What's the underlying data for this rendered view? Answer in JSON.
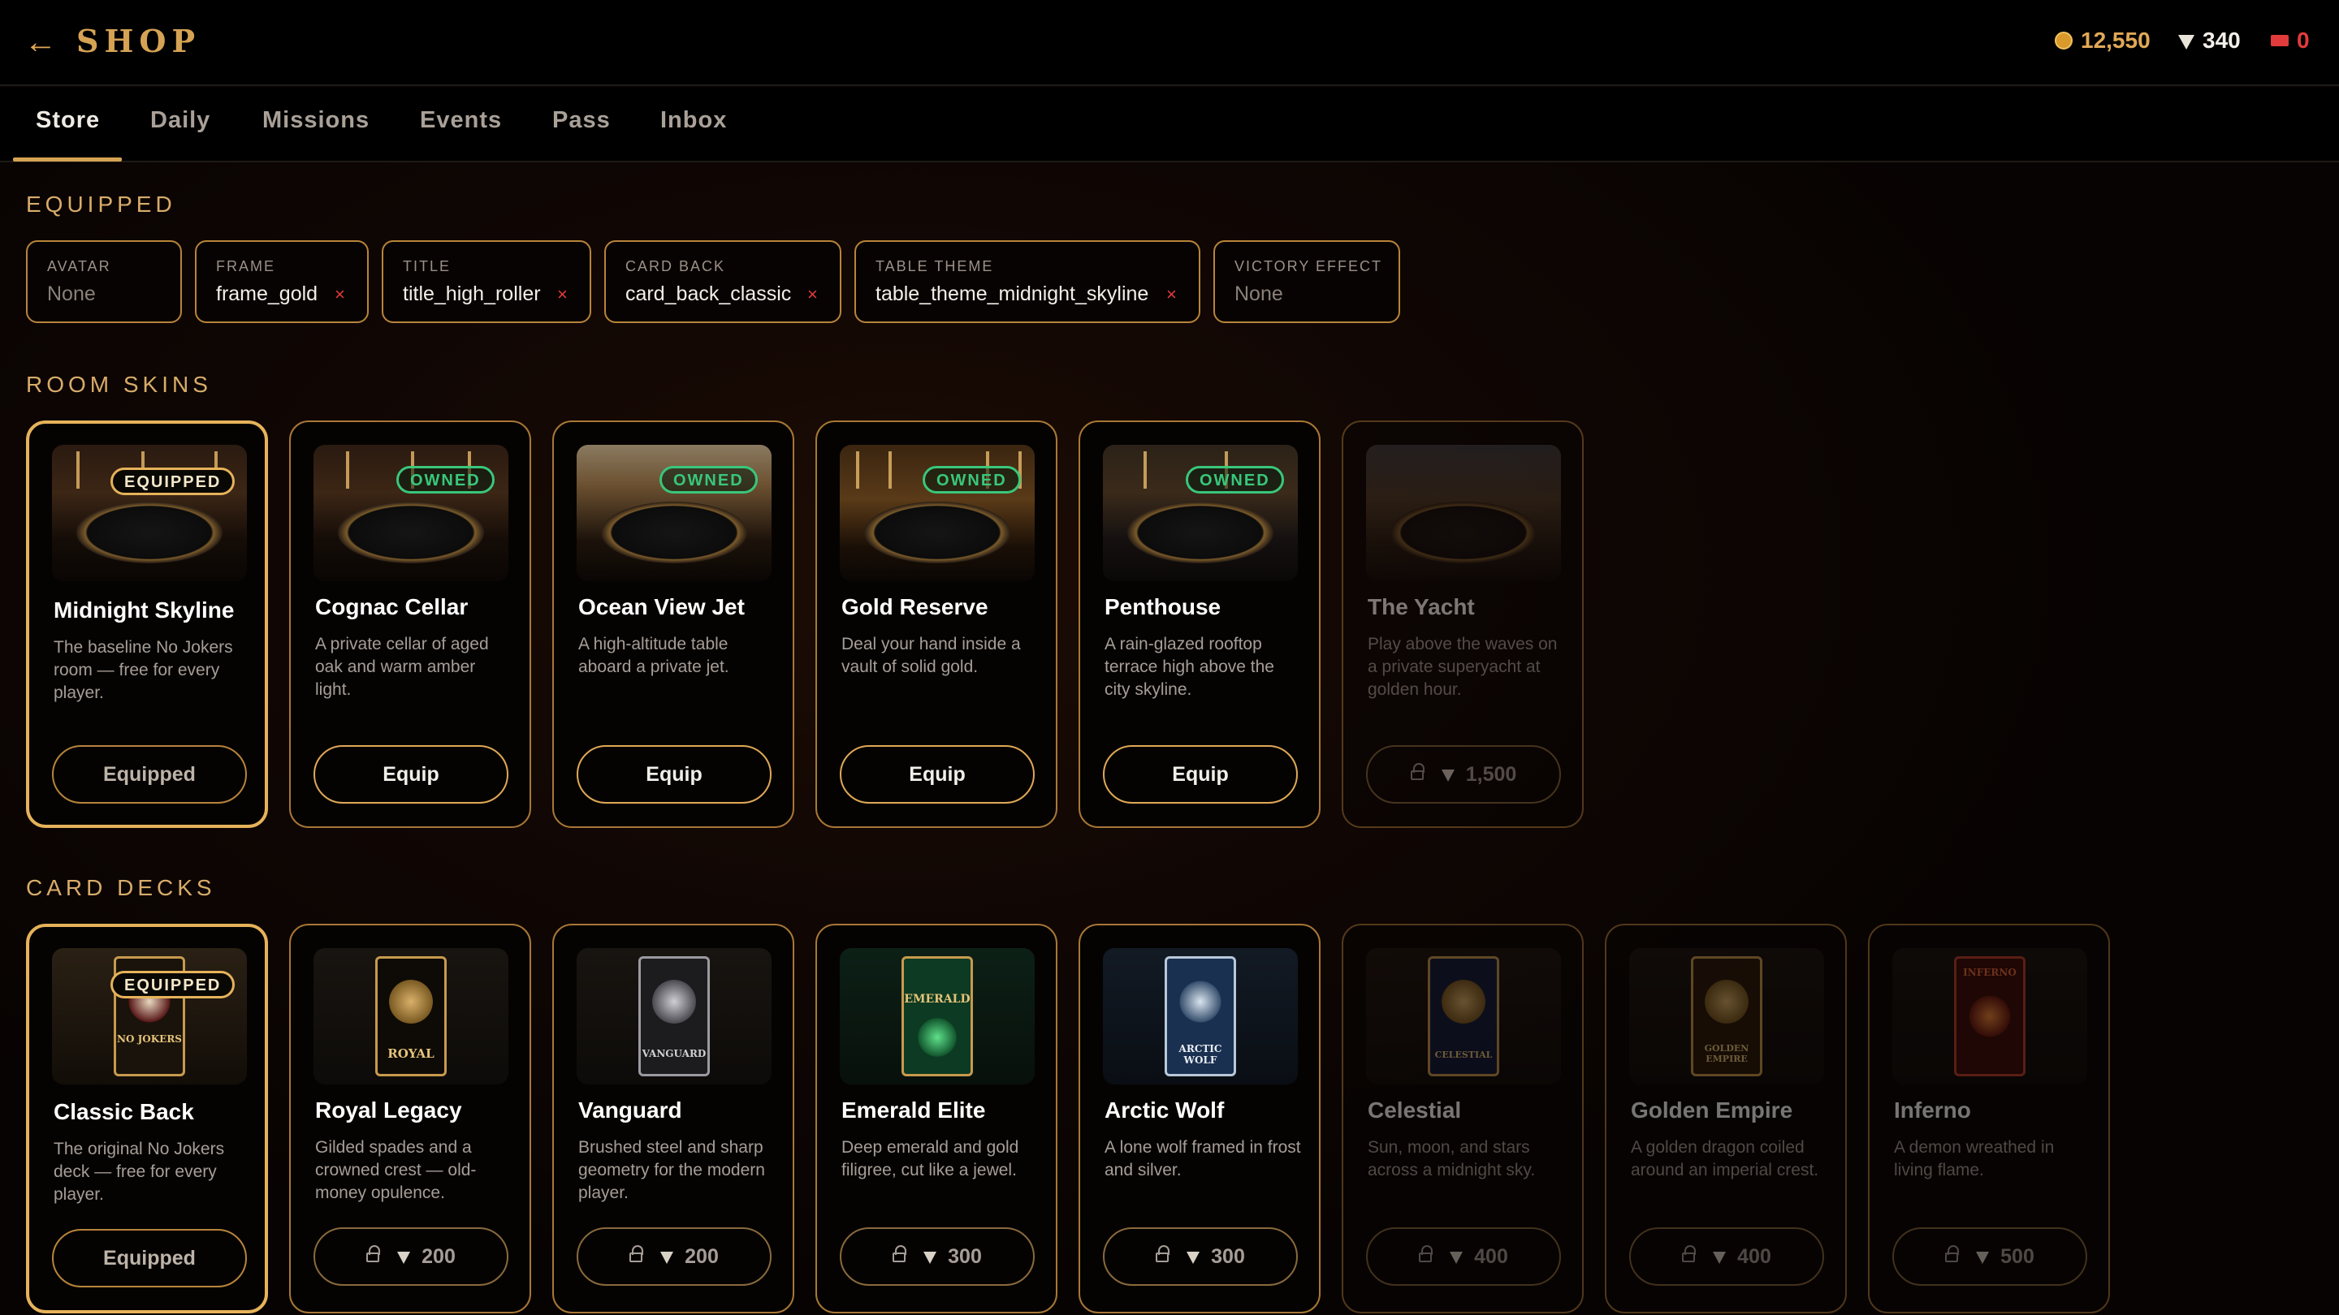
{
  "header": {
    "back_icon": "arrow-left-icon",
    "title": "SHOP",
    "currencies": {
      "coins": "12,550",
      "gems": "340",
      "tickets": "0"
    }
  },
  "colors": {
    "accent": "#d6a354",
    "owned": "#39c77a",
    "remove": "#e23b3b",
    "coins": "#e0a856",
    "tickets": "#e23b3b"
  },
  "tabs": [
    {
      "label": "Store",
      "active": true
    },
    {
      "label": "Daily"
    },
    {
      "label": "Missions"
    },
    {
      "label": "Events"
    },
    {
      "label": "Pass"
    },
    {
      "label": "Inbox"
    }
  ],
  "equipped": {
    "heading": "EQUIPPED",
    "slots": [
      {
        "label": "AVATAR",
        "value": "None"
      },
      {
        "label": "FRAME",
        "value": "frame_gold",
        "remove": "×"
      },
      {
        "label": "TITLE",
        "value": "title_high_roller",
        "remove": "×"
      },
      {
        "label": "CARD BACK",
        "value": "card_back_classic",
        "remove": "×"
      },
      {
        "label": "TABLE THEME",
        "value": "table_theme_midnight_skyline",
        "remove": "×"
      },
      {
        "label": "VICTORY EFFECT",
        "value": "None"
      }
    ]
  },
  "room_skins": {
    "heading": "ROOM SKINS",
    "items": [
      {
        "name": "Midnight Skyline",
        "desc": "The baseline No Jokers room — free for every player.",
        "badge": "EQUIPPED",
        "action": "Equipped"
      },
      {
        "name": "Cognac Cellar",
        "desc": "A private cellar of aged oak and warm amber light.",
        "badge": "OWNED",
        "action": "Equip"
      },
      {
        "name": "Ocean View Jet",
        "desc": "A high-altitude table aboard a private jet.",
        "badge": "OWNED",
        "action": "Equip"
      },
      {
        "name": "Gold Reserve",
        "desc": "Deal your hand inside a vault of solid gold.",
        "badge": "OWNED",
        "action": "Equip"
      },
      {
        "name": "Penthouse",
        "desc": "A rain-glazed rooftop terrace high above the city skyline.",
        "badge": "OWNED",
        "action": "Equip"
      },
      {
        "name": "The Yacht",
        "desc": "Play above the waves on a private superyacht at golden hour.",
        "price": "1,500"
      }
    ]
  },
  "card_decks": {
    "heading": "CARD DECKS",
    "items": [
      {
        "name": "Classic Back",
        "desc": "The original No Jokers deck — free for every player.",
        "badge": "EQUIPPED",
        "action": "Equipped",
        "art": "NO JOKERS"
      },
      {
        "name": "Royal Legacy",
        "desc": "Gilded spades and a crowned crest — old-money opulence.",
        "price": "200",
        "art": "ROYAL"
      },
      {
        "name": "Vanguard",
        "desc": "Brushed steel and sharp geometry for the modern player.",
        "price": "200",
        "art": "VANGUARD"
      },
      {
        "name": "Emerald Elite",
        "desc": "Deep emerald and gold filigree, cut like a jewel.",
        "price": "300",
        "art": "EMERALD"
      },
      {
        "name": "Arctic Wolf",
        "desc": "A lone wolf framed in frost and silver.",
        "price": "300",
        "art": "ARCTIC WOLF"
      },
      {
        "name": "Celestial",
        "desc": "Sun, moon, and stars across a midnight sky.",
        "price": "400",
        "art": "CELESTIAL"
      },
      {
        "name": "Golden Empire",
        "desc": "A golden dragon coiled around an imperial crest.",
        "price": "400",
        "art": "GOLDEN EMPIRE"
      },
      {
        "name": "Inferno",
        "desc": "A demon wreathed in living flame.",
        "price": "500",
        "art": "INFERNO"
      }
    ]
  }
}
